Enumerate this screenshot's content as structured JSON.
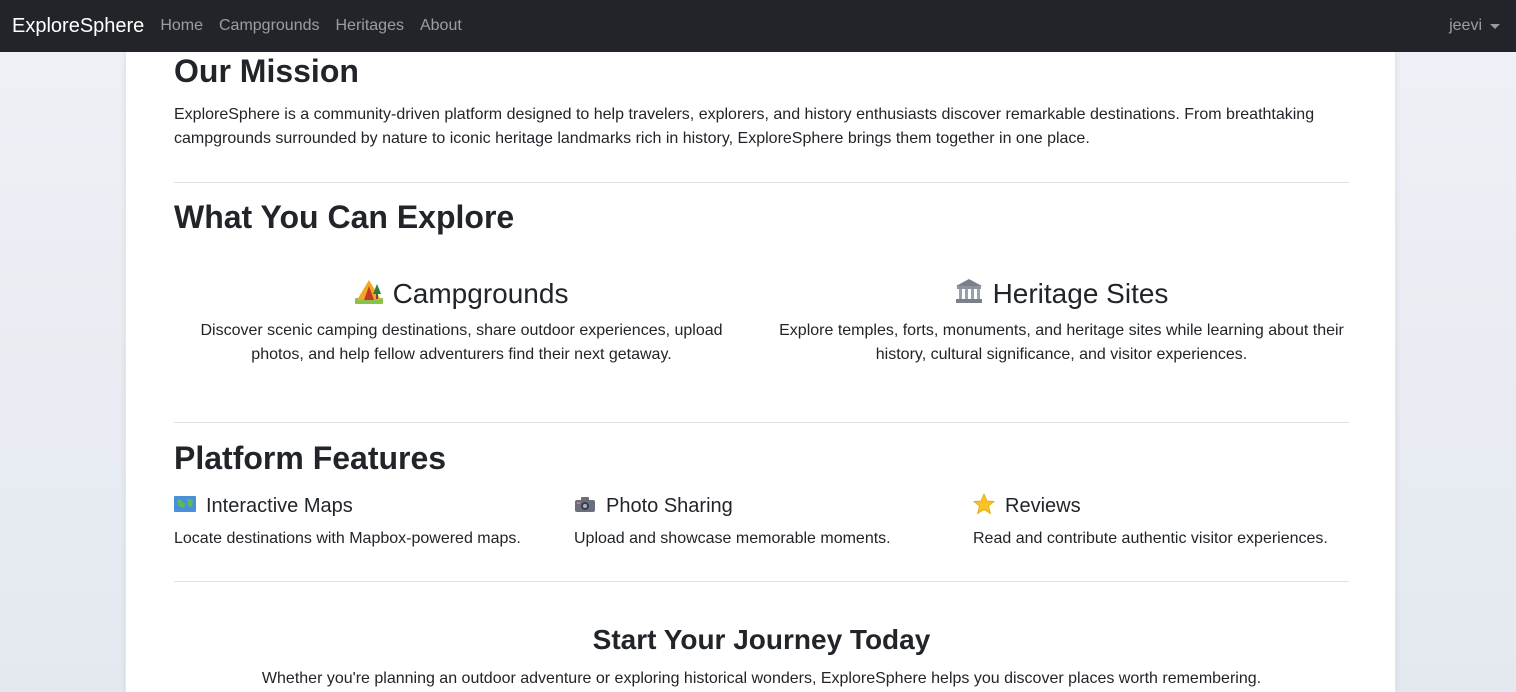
{
  "navbar": {
    "brand": "ExploreSphere",
    "links": [
      "Home",
      "Campgrounds",
      "Heritages",
      "About"
    ],
    "user": "jeevi"
  },
  "mission": {
    "heading": "Our Mission",
    "text": "ExploreSphere is a community-driven platform designed to help travelers, explorers, and history enthusiasts discover remarkable destinations. From breathtaking campgrounds surrounded by nature to iconic heritage landmarks rich in history, ExploreSphere brings them together in one place."
  },
  "explore": {
    "heading": "What You Can Explore",
    "items": [
      {
        "icon": "camping-icon",
        "title": "Campgrounds",
        "text": "Discover scenic camping destinations, share outdoor experiences, upload photos, and help fellow adventurers find their next getaway."
      },
      {
        "icon": "classical-building-icon",
        "title": "Heritage Sites",
        "text": "Explore temples, forts, monuments, and heritage sites while learning about their history, cultural significance, and visitor experiences."
      }
    ]
  },
  "features": {
    "heading": "Platform Features",
    "items": [
      {
        "icon": "world-map-icon",
        "title": "Interactive Maps",
        "text": "Locate destinations with Mapbox-powered maps."
      },
      {
        "icon": "camera-icon",
        "title": "Photo Sharing",
        "text": "Upload and showcase memorable moments."
      },
      {
        "icon": "star-icon",
        "title": "Reviews",
        "text": "Read and contribute authentic visitor experiences."
      }
    ]
  },
  "journey": {
    "heading": "Start Your Journey Today",
    "text": "Whether you're planning an outdoor adventure or exploring historical wonders, ExploreSphere helps you discover places worth remembering."
  },
  "colors": {
    "navbar_bg": "#212529",
    "page_bg": "#eef1f6",
    "card_bg": "#ffffff",
    "text": "#212529",
    "divider": "#dee2e6"
  }
}
